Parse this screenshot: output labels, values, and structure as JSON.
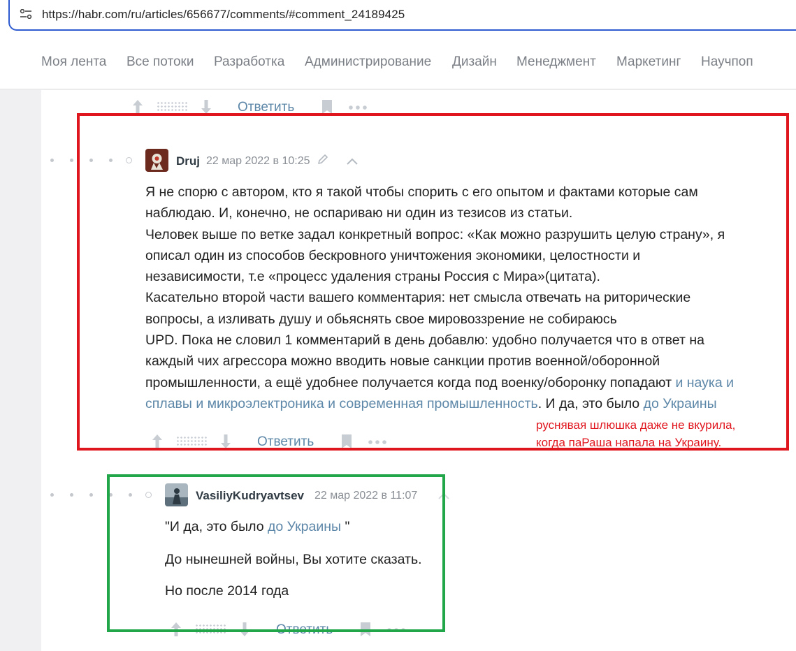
{
  "browser": {
    "url": "https://habr.com/ru/articles/656677/comments/#comment_24189425"
  },
  "nav": {
    "items": [
      "Моя лента",
      "Все потоки",
      "Разработка",
      "Администрирование",
      "Дизайн",
      "Менеджмент",
      "Маркетинг",
      "Научпоп"
    ]
  },
  "actions": {
    "reply_label": "Ответить"
  },
  "comment1": {
    "author": "Druj",
    "date": "22 мар 2022 в 10:25",
    "lines": [
      "Я не спорю с автором, кто я такой чтобы спорить с его опытом и фактами которые сам",
      "наблюдаю. И, конечно, не оспариваю ни один из тезисов из статьи.",
      "Человек выше по ветке задал конкретный вопрос: «Как можно разрушить целую страну», я",
      "описал один из способов бескровного уничтожения экономики, целостности и",
      "независимости, т.е «процесс удаления страны Россия с Мира»(цитата).",
      "Касательно второй части вашего комментария: нет смысла отвечать на риторические",
      "вопросы, а изливать душу и обьяснять свое мировоззрение не собираюсь",
      "UPD. Пока не словил 1 комментарий в день добавлю: удобно получается что в ответ на",
      "каждый чих агрессора можно вводить новые санкции против военной/оборонной"
    ],
    "line10_text": "промышленности, а ещё удобнее получается когда под военку/оборонку попадают ",
    "line10_link": "и наука и",
    "line11_link": "сплавы и микроэлектроника и современная промышленность",
    "line11_text": ". И да, это было ",
    "line11_link2": "до Украины"
  },
  "annotation": {
    "line1": "руснявая шлюшка даже не вкурила,",
    "line2": "когда паРаша напала на Украину."
  },
  "comment2": {
    "author": "VasiliyKudryavtsev",
    "date": "22 мар 2022 в 11:07",
    "quote_open": "\"И да, это было ",
    "quote_link": "до Украины",
    "quote_close": " \"",
    "line2": "До нынешней войны, Вы хотите сказать.",
    "line3": "Но после 2014 года"
  },
  "colors": {
    "accent_link": "#5d87a8",
    "red_frame": "#e0161e",
    "green_frame": "#22a64a",
    "url_border": "#2f5bd0"
  }
}
